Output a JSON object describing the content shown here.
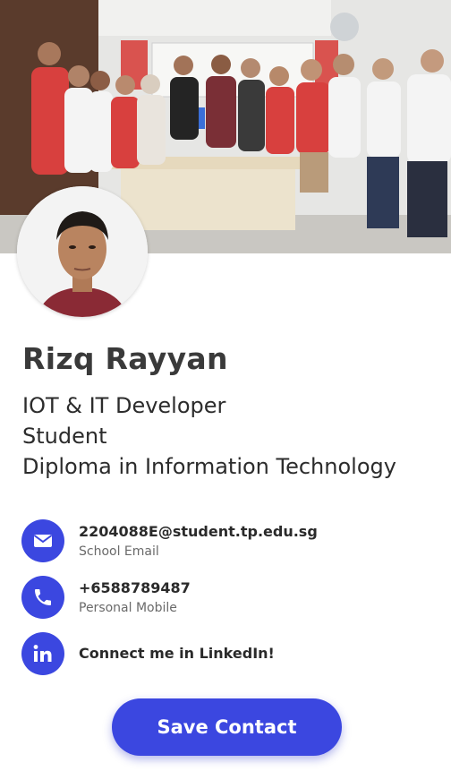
{
  "profile": {
    "name": "Rizq Rayyan",
    "titles": [
      "IOT & IT Developer",
      "Student",
      "Diploma in Information Technology"
    ]
  },
  "contacts": [
    {
      "icon": "email-icon",
      "value": "2204088E@student.tp.edu.sg",
      "label": "School Email"
    },
    {
      "icon": "phone-icon",
      "value": "+6588789487",
      "label": "Personal Mobile"
    },
    {
      "icon": "linkedin-icon",
      "value": "Connect me in LinkedIn!"
    }
  ],
  "actions": {
    "save_label": "Save Contact"
  },
  "colors": {
    "accent": "#3b47e0",
    "icon_fg": "#ffffff",
    "text": "#2b2b2b",
    "muted": "#6a6a6a"
  }
}
